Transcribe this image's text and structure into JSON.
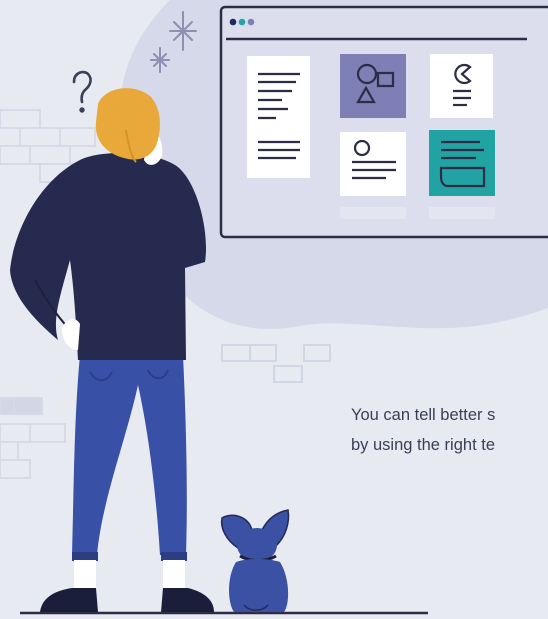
{
  "caption": {
    "line1": "You can tell better s",
    "line2": "by using the right te"
  },
  "colors": {
    "background": "#e8eaf1",
    "blob": "#d6d9e9",
    "window_border": "#2c2d45",
    "navy": "#262a4f",
    "jeans": "#3850a6",
    "hair": "#e9a93a",
    "skin": "#f2f0ea",
    "dog": "#3b51a3",
    "purple_card": "#7d7fb5",
    "teal_card": "#21a3a4",
    "dot_navy": "#1e2c5c",
    "dot_teal": "#23a4a6",
    "dot_purple": "#7e7fb6"
  },
  "icons": [
    "sparkle-icon",
    "question-mark-icon",
    "window-dots-icon",
    "text-lines-icon",
    "shapes-icon",
    "pie-chart-icon",
    "avatar-icon",
    "image-card-icon"
  ]
}
